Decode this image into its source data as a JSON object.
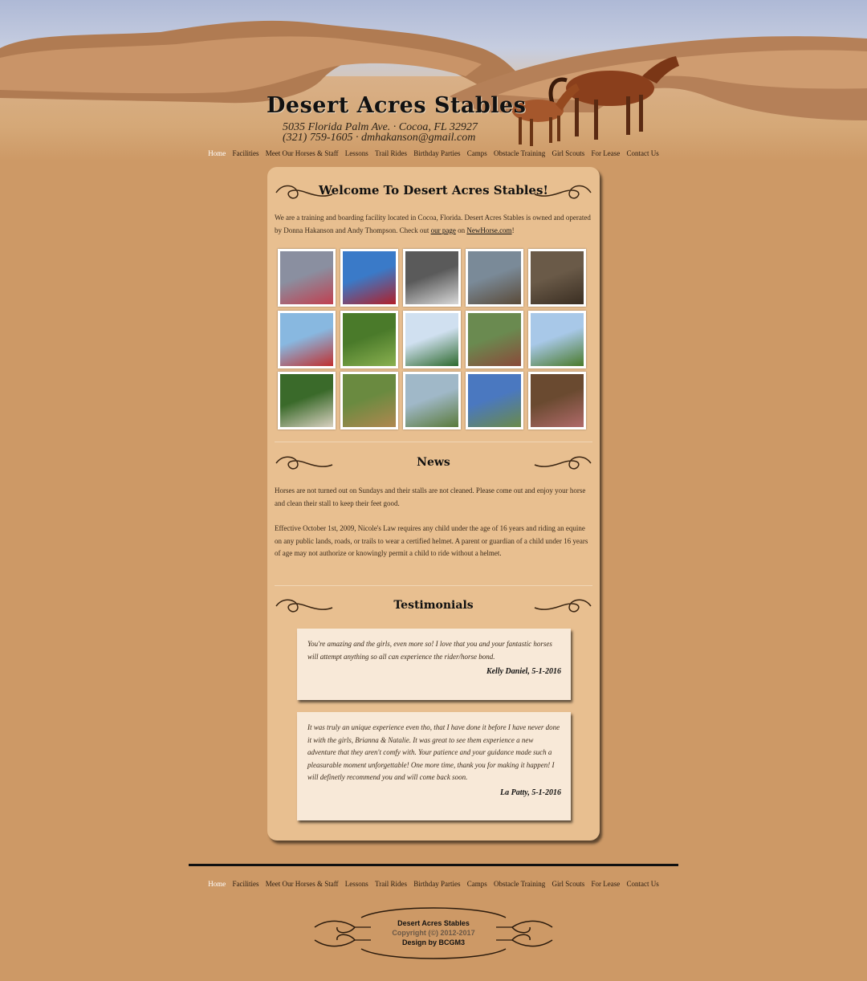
{
  "site": {
    "title": "Desert Acres Stables",
    "address_line": "5035 Florida Palm Ave. · Cocoa, FL 32927",
    "contact_line": "(321) 759-1605 · dmhakanson@gmail.com"
  },
  "nav": [
    {
      "label": "Home",
      "active": true
    },
    {
      "label": "Facilities"
    },
    {
      "label": "Meet Our Horses & Staff"
    },
    {
      "label": "Lessons"
    },
    {
      "label": "Trail Rides"
    },
    {
      "label": "Birthday Parties"
    },
    {
      "label": "Camps"
    },
    {
      "label": "Obstacle Training"
    },
    {
      "label": "Girl Scouts"
    },
    {
      "label": "For Lease"
    },
    {
      "label": "Contact Us"
    }
  ],
  "welcome": {
    "title": "Welcome To Desert Acres Stables!",
    "intro_text": "We are a training and boarding facility located in Cocoa, Florida. Desert Acres Stables is owned and operated by Donna Hakanson and Andy Thompson. Check out ",
    "link_our_page": "our page",
    "link_connector": " on ",
    "link_newhorse": "NewHorse.com",
    "intro_end": "!"
  },
  "gallery": {
    "photos": [
      "cowgirl-with-hat",
      "red-barn",
      "rider-in-hat-bw",
      "horses-in-water",
      "people-and-horse",
      "horse-cart-parade",
      "rider-galloping",
      "riders-by-barn",
      "group-on-horseback",
      "hay-wagon-ride",
      "horse-and-handler",
      "obstacle-course",
      "kids-group",
      "riders-at-pond",
      "kids-in-hay"
    ]
  },
  "news": {
    "title": "News",
    "items": [
      "Horses are not turned out on Sundays and their stalls are not cleaned. Please come out and enjoy your horse and clean their stall to keep their feet good.",
      "Effective October 1st, 2009, Nicole's Law requires any child under the age of 16 years and riding an equine on any public lands, roads, or trails to wear a certified helmet. A parent or guardian of a child under 16 years of age may not authorize or knowingly permit a child to ride without a helmet."
    ]
  },
  "testimonials": {
    "title": "Testimonials",
    "items": [
      {
        "text": "You're amazing and the girls, even more so! I love that you and your fantastic horses will attempt anything so all can experience the rider/horse bond.",
        "author": "Kelly Daniel, 5-1-2016"
      },
      {
        "text": "It was truly an unique experience even tho, that I have done it before I have never done it with the girls, Brianna & Natalie. It was great to see them experience a new adventure that they aren't comfy with. Your patience and your guidance made such a pleasurable moment unforgettable! One more time, thank you for making it happen! I will definetly recommend you and will come back soon.",
        "author": "La Patty, 5-1-2016"
      }
    ]
  },
  "footer": {
    "line1": "Desert Acres Stables",
    "line2": "Copyright (©) 2012-2017",
    "line3": "Design by BCGM3"
  },
  "colors": {
    "page_background": "#cd9966",
    "panel_background": "#e8bf90",
    "quote_background": "#f8e9d8",
    "nav_active": "#ffffff"
  }
}
